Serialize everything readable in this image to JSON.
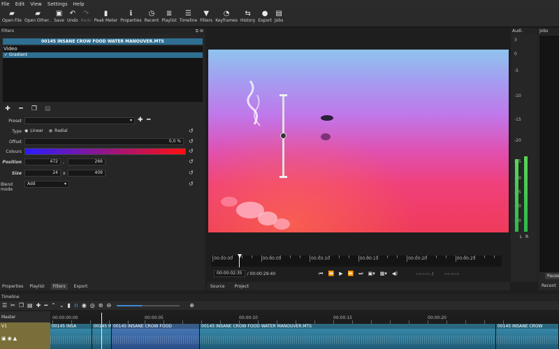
{
  "menu": [
    "File",
    "Edit",
    "View",
    "Settings",
    "Help"
  ],
  "toolbar": [
    {
      "label": "Open File",
      "icon": "folder-icon",
      "glyph": "▰"
    },
    {
      "label": "Open Other..",
      "icon": "folder-open-icon",
      "glyph": "▰"
    },
    {
      "label": "Save",
      "icon": "save-icon",
      "glyph": "▣"
    },
    {
      "label": "Undo",
      "icon": "undo-icon",
      "glyph": "↶"
    },
    {
      "label": "Redo",
      "icon": "redo-icon",
      "glyph": "↷",
      "disabled": true
    },
    {
      "label": "Peak Meter",
      "icon": "peak-meter-icon",
      "glyph": "▮"
    },
    {
      "label": "Properties",
      "icon": "info-icon",
      "glyph": "ℹ"
    },
    {
      "label": "Recent",
      "icon": "clock-icon",
      "glyph": "◷"
    },
    {
      "label": "Playlist",
      "icon": "playlist-icon",
      "glyph": "≣"
    },
    {
      "label": "Timeline",
      "icon": "timeline-icon",
      "glyph": "☰"
    },
    {
      "label": "Filters",
      "icon": "funnel-icon",
      "glyph": "▼"
    },
    {
      "label": "Keyframes",
      "icon": "stopwatch-icon",
      "glyph": "◔"
    },
    {
      "label": "History",
      "icon": "history-icon",
      "glyph": "⇆"
    },
    {
      "label": "Export",
      "icon": "export-icon",
      "glyph": "●"
    },
    {
      "label": "Jobs",
      "icon": "jobs-icon",
      "glyph": "▤"
    }
  ],
  "filters": {
    "title": "Filters",
    "clip_name": "00145 INSANE CROW FOOD WATER MANOUVER.MTS",
    "list_header": "Video",
    "filter_item": "Gradient",
    "preset_label": "Preset",
    "type_label": "Type",
    "type_linear": "Linear",
    "type_radial": "Radial",
    "offset_label": "Offset",
    "offset_value": "0,0 %",
    "colours_label": "Colours",
    "colour_start": "#2a1cff",
    "colour_end": "#ff1010",
    "position_label": "Position",
    "position_x": "472",
    "position_sep": ",",
    "position_y": "266",
    "size_label": "Size",
    "size_w": "24",
    "size_sep": "x",
    "size_h": "409",
    "blend_label": "Blend mode",
    "blend_value": "Add"
  },
  "viewer": {
    "ruler_labels": [
      "00:00:00",
      "00:00:05",
      "00:00:10",
      "00:00:15",
      "00:00:20",
      "00:00:25"
    ],
    "current_time": "00:00:02:35",
    "total_time": "/ 00:00:29:40",
    "in_point": "--:--:--:- /",
    "out_point": "--:--:--:-",
    "tabs": [
      "Source",
      "Project"
    ]
  },
  "audio": {
    "title": "Audi.",
    "scale": [
      "3",
      "0",
      "-5",
      "-10",
      "-15",
      "-20",
      "-25",
      "-30",
      "-35",
      "-40",
      "-50"
    ],
    "channels": [
      "L",
      "R"
    ],
    "level_left": 0.8,
    "level_right": 0.83
  },
  "jobs": {
    "title": "Jobs",
    "pause": "Pause"
  },
  "left_tabs": [
    "Properties",
    "Playlist",
    "Filters",
    "Export"
  ],
  "right_tab": "Recent",
  "timeline": {
    "title": "Timeline",
    "master": "Master",
    "track": "V1",
    "ruler_labels": [
      "00:00:00:00",
      "00:00:05",
      "00:00:10",
      "00:00:15",
      "00:00:20"
    ],
    "clips": [
      {
        "label": "00145 INSA"
      },
      {
        "label": "00145 INSANE CROW"
      },
      {
        "label": "00145 INSANE CROW FOOD"
      },
      {
        "label": "00145 INSANE CROW FOOD WATER MANOUVER.MTS"
      },
      {
        "label": "00145 INSANE CROW"
      }
    ]
  }
}
